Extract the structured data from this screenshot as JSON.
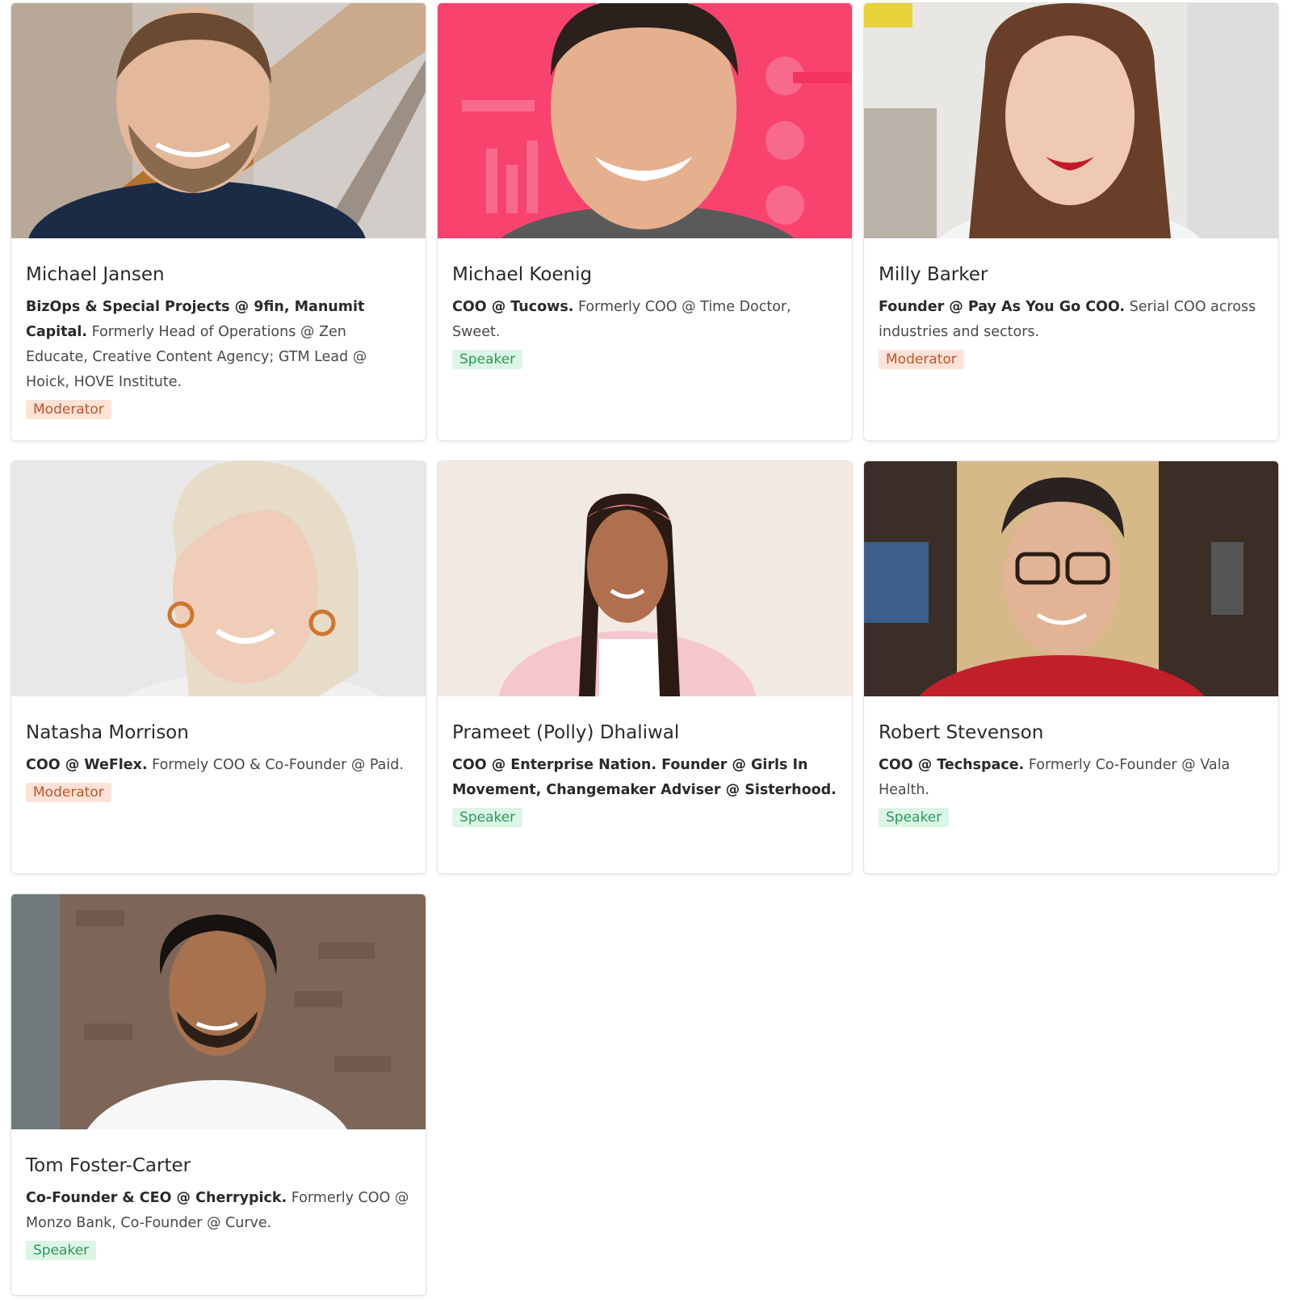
{
  "colors": {
    "moderator_bg": "#fde3d7",
    "moderator_text": "#c2542a",
    "speaker_bg": "#dcf5e6",
    "speaker_text": "#2b9a5a"
  },
  "speakers": [
    {
      "name": "Michael Jansen",
      "bio_bold": "BizOps & Special Projects @ 9fin, Manumit Capital.",
      "bio_rest": " Formerly Head of Operations @ Zen Educate, Creative Content Agency; GTM Lead @ Hoick, HOVE Institute.",
      "role": "Moderator",
      "photo": "portrait-photo"
    },
    {
      "name": "Michael Koenig",
      "bio_bold": "COO @ Tucows.",
      "bio_rest": " Formerly COO @ Time Doctor, Sweet.",
      "role": "Speaker",
      "photo": "portrait-photo"
    },
    {
      "name": "Milly Barker",
      "bio_bold": "Founder @ Pay As You Go COO.",
      "bio_rest": " Serial COO across industries and sectors.",
      "role": "Moderator",
      "photo": "portrait-photo"
    },
    {
      "name": "Natasha Morrison",
      "bio_bold": "COO @ WeFlex.",
      "bio_rest": " Formely COO & Co-Founder @ Paid.",
      "role": "Moderator",
      "photo": "portrait-photo"
    },
    {
      "name": "Prameet (Polly) Dhaliwal",
      "bio_bold": "COO @ Enterprise Nation. Founder @ Girls In Movement, Changemaker Adviser @ Sisterhood.",
      "bio_rest": "",
      "role": "Speaker",
      "photo": "portrait-photo"
    },
    {
      "name": "Robert Stevenson",
      "bio_bold": "COO @ Techspace.",
      "bio_rest": " Formerly Co-Founder @ Vala Health.",
      "role": "Speaker",
      "photo": "portrait-photo"
    },
    {
      "name": "Tom Foster-Carter",
      "bio_bold": "Co-Founder & CEO @ Cherrypick.",
      "bio_rest": " Formerly COO @ Monzo Bank, Co-Founder @ Curve.",
      "role": "Speaker",
      "photo": "portrait-photo"
    }
  ]
}
